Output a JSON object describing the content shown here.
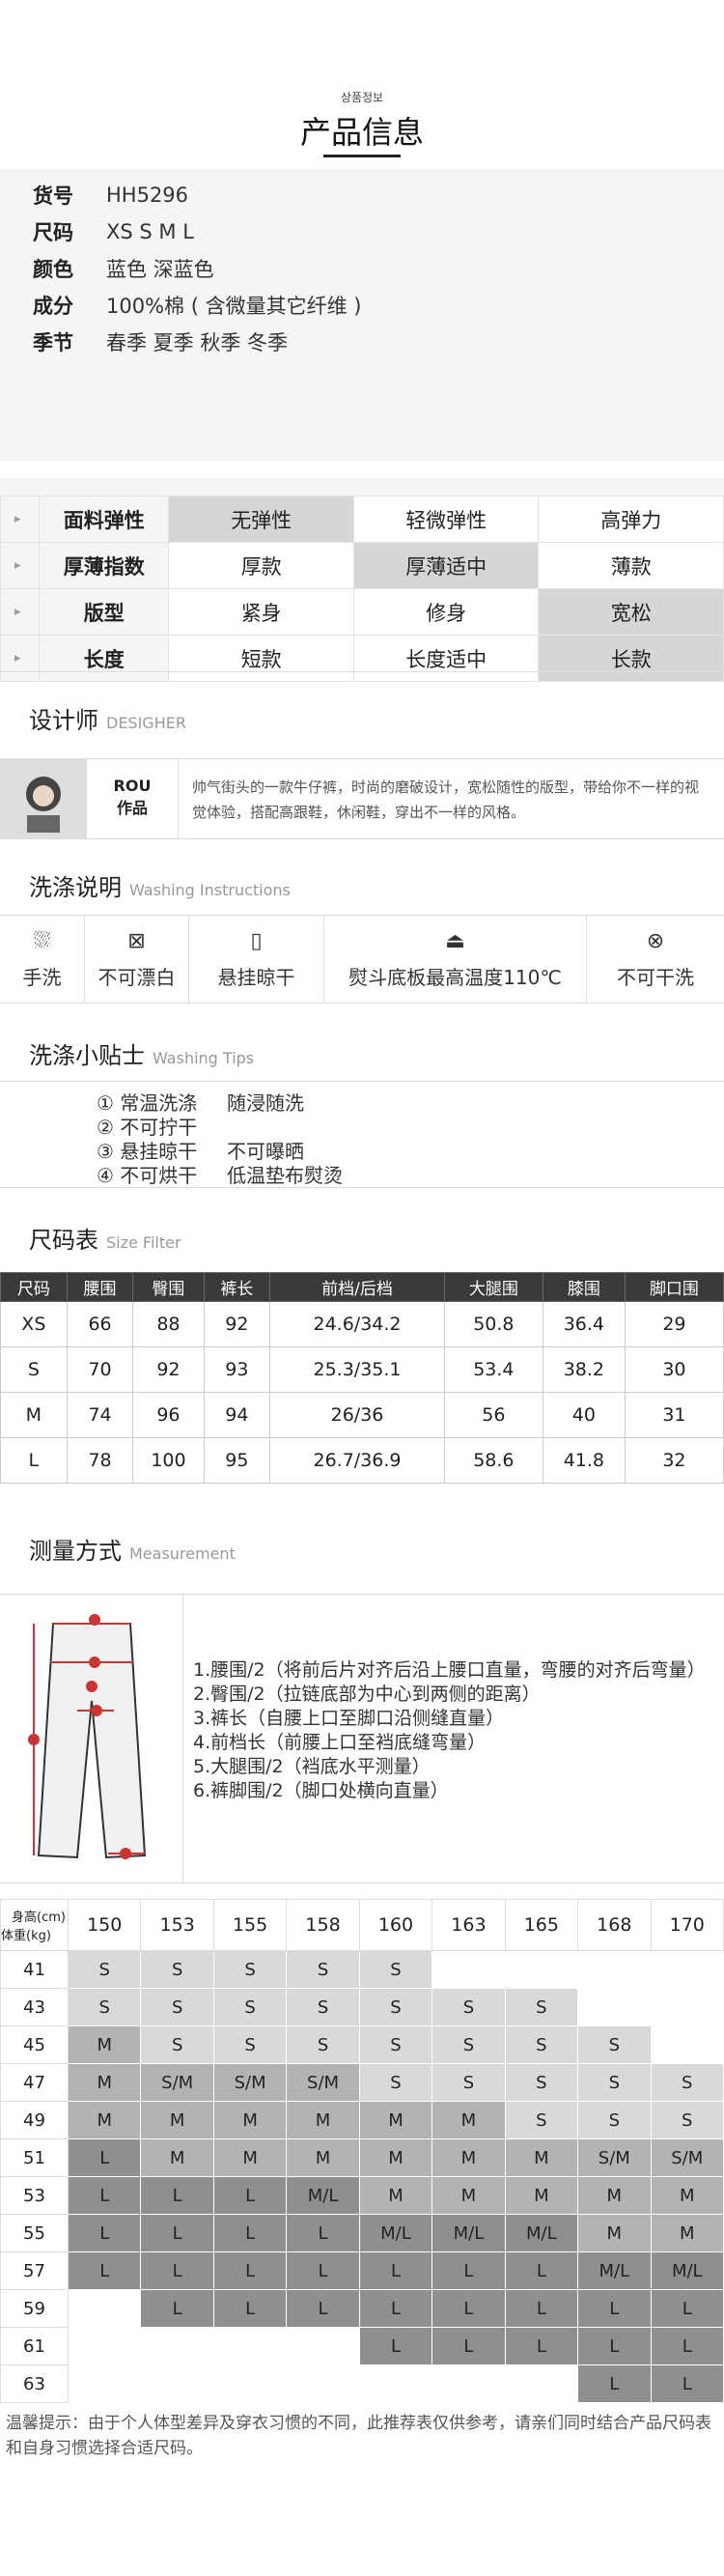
{
  "header": {
    "small": "상품정보",
    "title": "产品信息"
  },
  "info": [
    {
      "k": "货号",
      "v": "HH5296"
    },
    {
      "k": "尺码",
      "v": "XS S M L"
    },
    {
      "k": "颜色",
      "v": "蓝色 深蓝色"
    },
    {
      "k": "成分",
      "v": "100%棉 ( 含微量其它纤维 )"
    },
    {
      "k": "季节",
      "v": "春季 夏季 秋季 冬季"
    }
  ],
  "attributes": [
    {
      "name": "面料弹性",
      "opts": [
        "无弹性",
        "轻微弹性",
        "高弹力"
      ],
      "sel": 0
    },
    {
      "name": "厚薄指数",
      "opts": [
        "厚款",
        "厚薄适中",
        "薄款"
      ],
      "sel": 1
    },
    {
      "name": "版型",
      "opts": [
        "紧身",
        "修身",
        "宽松"
      ],
      "sel": 2
    },
    {
      "name": "长度",
      "opts": [
        "短款",
        "长度适中",
        "长款"
      ],
      "sel": 2
    }
  ],
  "designer": {
    "title": "设计师",
    "en": "DESIGHER",
    "name": "ROU",
    "works": "作品",
    "text": "帅气街头的一款牛仔裤，时尚的磨破设计，宽松随性的版型，带给你不一样的视觉体验，搭配高跟鞋，休闲鞋，穿出不一样的风格。"
  },
  "washing": {
    "title": "洗涤说明",
    "en": "Washing Instructions",
    "items": [
      "手洗",
      "不可漂白",
      "悬挂晾干",
      "熨斗底板最高温度110℃",
      "不可干洗"
    ]
  },
  "tips": {
    "title": "洗涤小贴士",
    "en": "Washing Tips",
    "rows": [
      [
        "① 常温洗涤",
        "随浸随洗"
      ],
      [
        "② 不可拧干",
        ""
      ],
      [
        "③ 悬挂晾干",
        "不可曝晒"
      ],
      [
        "④ 不可烘干",
        "低温垫布熨烫"
      ]
    ]
  },
  "sizeTable": {
    "title": "尺码表",
    "en": "Size Filter",
    "headers": [
      "尺码",
      "腰围",
      "臀围",
      "裤长",
      "前档/后档",
      "大腿围",
      "膝围",
      "脚口围"
    ],
    "rows": [
      [
        "XS",
        "66",
        "88",
        "92",
        "24.6/34.2",
        "50.8",
        "36.4",
        "29"
      ],
      [
        "S",
        "70",
        "92",
        "93",
        "25.3/35.1",
        "53.4",
        "38.2",
        "30"
      ],
      [
        "M",
        "74",
        "96",
        "94",
        "26/36",
        "56",
        "40",
        "31"
      ],
      [
        "L",
        "78",
        "100",
        "95",
        "26.7/36.9",
        "58.6",
        "41.8",
        "32"
      ]
    ]
  },
  "measurement": {
    "title": "测量方式",
    "en": "Measurement",
    "items": [
      "1.腰围/2（将前后片对齐后沿上腰口直量，弯腰的对齐后弯量）",
      "2.臀围/2（拉链底部为中心到两侧的距离）",
      "3.裤长（自腰上口至脚口沿侧缝直量）",
      "4.前档长（前腰上口至裆底缝弯量）",
      "5.大腿围/2（裆底水平测量）",
      "6.裤脚围/2（脚口处横向直量）"
    ]
  },
  "recommend": {
    "heightLabel": "身高(cm)",
    "weightLabel": "体重(kg)",
    "heights": [
      "150",
      "153",
      "155",
      "158",
      "160",
      "163",
      "165",
      "168",
      "170"
    ],
    "rows": [
      {
        "w": "41",
        "c": [
          "S",
          "S",
          "S",
          "S",
          "S",
          "",
          "",
          "",
          ""
        ]
      },
      {
        "w": "43",
        "c": [
          "S",
          "S",
          "S",
          "S",
          "S",
          "S",
          "S",
          "",
          ""
        ]
      },
      {
        "w": "45",
        "c": [
          "M",
          "S",
          "S",
          "S",
          "S",
          "S",
          "S",
          "S",
          ""
        ]
      },
      {
        "w": "47",
        "c": [
          "M",
          "S/M",
          "S/M",
          "S/M",
          "S",
          "S",
          "S",
          "S",
          "S"
        ]
      },
      {
        "w": "49",
        "c": [
          "M",
          "M",
          "M",
          "M",
          "M",
          "M",
          "S",
          "S",
          "S"
        ]
      },
      {
        "w": "51",
        "c": [
          "L",
          "M",
          "M",
          "M",
          "M",
          "M",
          "M",
          "S/M",
          "S/M"
        ]
      },
      {
        "w": "53",
        "c": [
          "L",
          "L",
          "L",
          "M/L",
          "M",
          "M",
          "M",
          "M",
          "M"
        ]
      },
      {
        "w": "55",
        "c": [
          "L",
          "L",
          "L",
          "L",
          "M/L",
          "M/L",
          "M/L",
          "M",
          "M"
        ]
      },
      {
        "w": "57",
        "c": [
          "L",
          "L",
          "L",
          "L",
          "L",
          "L",
          "L",
          "M/L",
          "M/L"
        ]
      },
      {
        "w": "59",
        "c": [
          "",
          "L",
          "L",
          "L",
          "L",
          "L",
          "L",
          "L",
          "L"
        ]
      },
      {
        "w": "61",
        "c": [
          "",
          "",
          "",
          "",
          "L",
          "L",
          "L",
          "L",
          "L"
        ]
      },
      {
        "w": "63",
        "c": [
          "",
          "",
          "",
          "",
          "",
          "",
          "",
          "L",
          "L"
        ]
      }
    ],
    "shade": [
      [
        1,
        1,
        1,
        1,
        1,
        0,
        0,
        0,
        0
      ],
      [
        1,
        1,
        1,
        1,
        1,
        1,
        1,
        0,
        0
      ],
      [
        2,
        1,
        1,
        1,
        1,
        1,
        1,
        1,
        0
      ],
      [
        2,
        2,
        2,
        2,
        1,
        1,
        1,
        1,
        1
      ],
      [
        2,
        2,
        2,
        2,
        2,
        2,
        1,
        1,
        1
      ],
      [
        3,
        2,
        2,
        2,
        2,
        2,
        2,
        2,
        2
      ],
      [
        3,
        3,
        3,
        3,
        2,
        2,
        2,
        2,
        2
      ],
      [
        3,
        3,
        3,
        3,
        3,
        3,
        3,
        2,
        2
      ],
      [
        3,
        3,
        3,
        3,
        3,
        3,
        3,
        3,
        3
      ],
      [
        0,
        3,
        3,
        3,
        3,
        3,
        3,
        3,
        3
      ],
      [
        0,
        0,
        0,
        0,
        3,
        3,
        3,
        3,
        3
      ],
      [
        0,
        0,
        0,
        0,
        0,
        0,
        0,
        3,
        3
      ]
    ]
  },
  "warm": "温馨提示：由于个人体型差异及穿衣习惯的不同，此推荐表仅供参考，请亲们同时结合产品尺码表和自身习惯选择合适尺码。"
}
